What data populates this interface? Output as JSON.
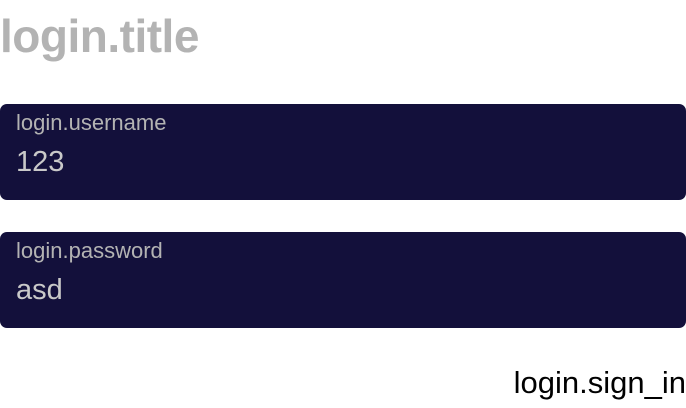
{
  "login": {
    "title": "login.title",
    "username": {
      "label": "login.username",
      "value": "123"
    },
    "password": {
      "label": "login.password",
      "value": "asd"
    },
    "sign_in_label": "login.sign_in"
  },
  "colors": {
    "field_background": "#13103b",
    "title_color": "#b3b3b3",
    "label_color": "#b3b3b3",
    "value_color": "#c9c9c9",
    "button_text_color": "#000000"
  }
}
